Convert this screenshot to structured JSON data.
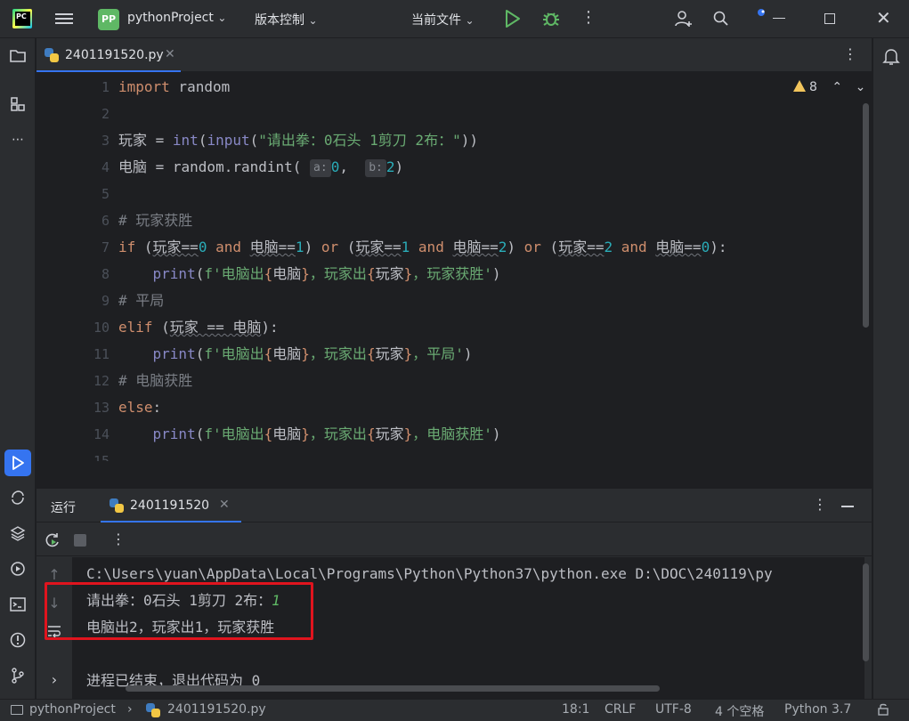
{
  "titlebar": {
    "project_badge": "PP",
    "project_name": "pythonProject",
    "vcs_label": "版本控制",
    "run_config": "当前文件"
  },
  "editor": {
    "tab_label": "2401191520.py",
    "warning_count": "8",
    "line_numbers": [
      "1",
      "2",
      "3",
      "4",
      "5",
      "6",
      "7",
      "8",
      "9",
      "10",
      "11",
      "12",
      "13",
      "14",
      "15"
    ]
  },
  "run_panel": {
    "label": "运行",
    "tab_label": "2401191520",
    "console": {
      "cmd_line": "C:\\Users\\yuan\\AppData\\Local\\Programs\\Python\\Python37\\python.exe D:\\DOC\\240119\\py",
      "prompt": "请出拳：0石头 1剪刀 2布：",
      "input_value": "1",
      "result": "电脑出2，玩家出1，玩家获胜",
      "exit_msg": "进程已结束，退出代码为 0"
    }
  },
  "statusbar": {
    "project": "pythonProject",
    "file": "2401191520.py",
    "position": "18:1",
    "line_sep": "CRLF",
    "encoding": "UTF-8",
    "indent": "4 个空格",
    "interpreter": "Python 3.7"
  },
  "colors": {
    "accent": "#3574f0",
    "run_green": "#5fb865",
    "highlight_red": "#e0141e"
  }
}
